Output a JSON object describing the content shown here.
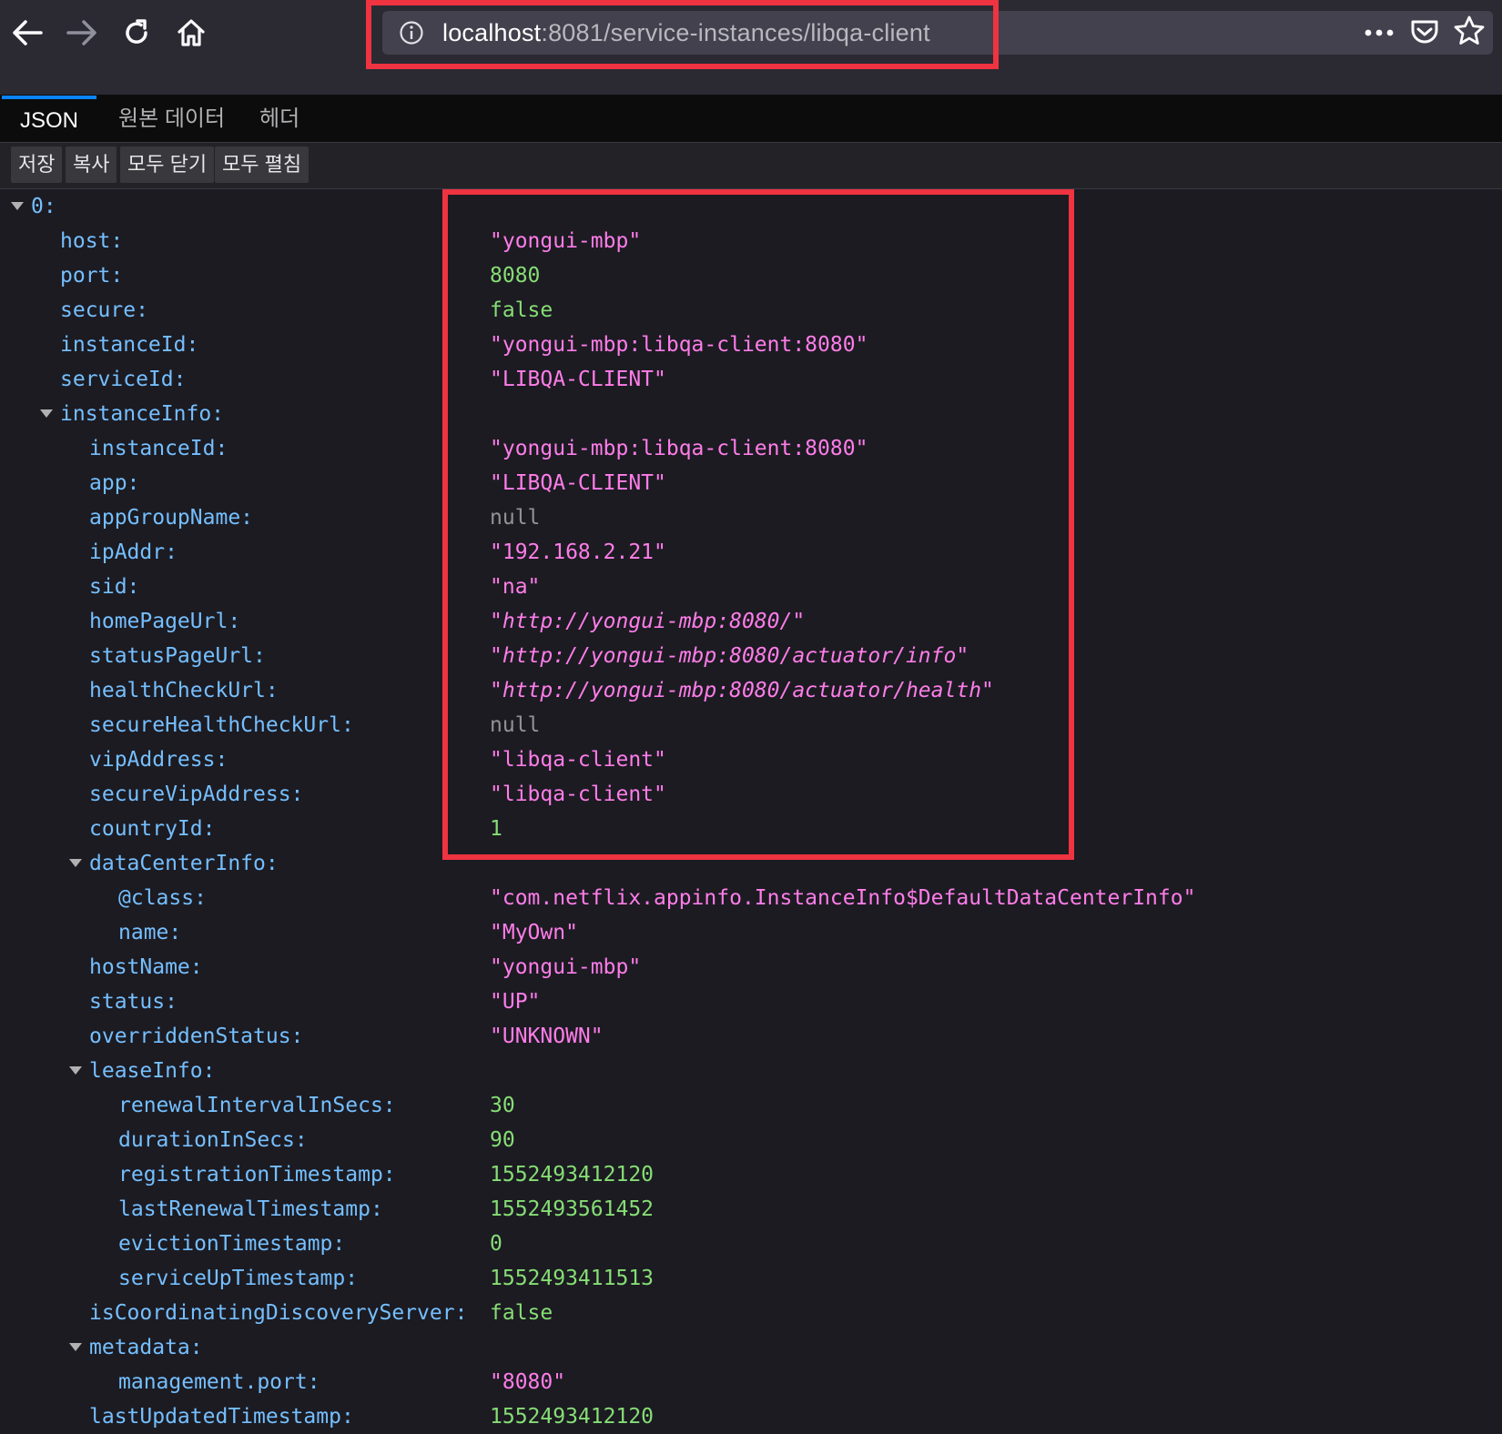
{
  "browser": {
    "url_host": "localhost",
    "url_path": ":8081/service-instances/libqa-client"
  },
  "tabs": [
    {
      "label": "JSON"
    },
    {
      "label": "원본 데이터"
    },
    {
      "label": "헤더"
    }
  ],
  "buttons": {
    "save": "저장",
    "copy": "복사",
    "collapse_all": "모두 닫기",
    "expand_all": "모두 펼침"
  },
  "tree": [
    {
      "key": "0:",
      "value": "",
      "type": "obj"
    },
    {
      "key": "host:",
      "value": "\"yongui-mbp\"",
      "type": "str"
    },
    {
      "key": "port:",
      "value": "8080",
      "type": "num"
    },
    {
      "key": "secure:",
      "value": "false",
      "type": "bool"
    },
    {
      "key": "instanceId:",
      "value": "\"yongui-mbp:libqa-client:8080\"",
      "type": "str"
    },
    {
      "key": "serviceId:",
      "value": "\"LIBQA-CLIENT\"",
      "type": "str"
    },
    {
      "key": "instanceInfo:",
      "value": "",
      "type": "obj"
    },
    {
      "key": "instanceId:",
      "value": "\"yongui-mbp:libqa-client:8080\"",
      "type": "str"
    },
    {
      "key": "app:",
      "value": "\"LIBQA-CLIENT\"",
      "type": "str"
    },
    {
      "key": "appGroupName:",
      "value": "null",
      "type": "nul"
    },
    {
      "key": "ipAddr:",
      "value": "\"192.168.2.21\"",
      "type": "str"
    },
    {
      "key": "sid:",
      "value": "\"na\"",
      "type": "str"
    },
    {
      "key": "homePageUrl:",
      "value": "\"http://yongui-mbp:8080/\"",
      "type": "url"
    },
    {
      "key": "statusPageUrl:",
      "value": "\"http://yongui-mbp:8080/actuator/info\"",
      "type": "url"
    },
    {
      "key": "healthCheckUrl:",
      "value": "\"http://yongui-mbp:8080/actuator/health\"",
      "type": "url"
    },
    {
      "key": "secureHealthCheckUrl:",
      "value": "null",
      "type": "nul"
    },
    {
      "key": "vipAddress:",
      "value": "\"libqa-client\"",
      "type": "str"
    },
    {
      "key": "secureVipAddress:",
      "value": "\"libqa-client\"",
      "type": "str"
    },
    {
      "key": "countryId:",
      "value": "1",
      "type": "num"
    },
    {
      "key": "dataCenterInfo:",
      "value": "",
      "type": "obj"
    },
    {
      "key": "@class:",
      "value": "\"com.netflix.appinfo.InstanceInfo$DefaultDataCenterInfo\"",
      "type": "str"
    },
    {
      "key": "name:",
      "value": "\"MyOwn\"",
      "type": "str"
    },
    {
      "key": "hostName:",
      "value": "\"yongui-mbp\"",
      "type": "str"
    },
    {
      "key": "status:",
      "value": "\"UP\"",
      "type": "str"
    },
    {
      "key": "overriddenStatus:",
      "value": "\"UNKNOWN\"",
      "type": "str"
    },
    {
      "key": "leaseInfo:",
      "value": "",
      "type": "obj"
    },
    {
      "key": "renewalIntervalInSecs:",
      "value": "30",
      "type": "num"
    },
    {
      "key": "durationInSecs:",
      "value": "90",
      "type": "num"
    },
    {
      "key": "registrationTimestamp:",
      "value": "1552493412120",
      "type": "num"
    },
    {
      "key": "lastRenewalTimestamp:",
      "value": "1552493561452",
      "type": "num"
    },
    {
      "key": "evictionTimestamp:",
      "value": "0",
      "type": "num"
    },
    {
      "key": "serviceUpTimestamp:",
      "value": "1552493411513",
      "type": "num"
    },
    {
      "key": "isCoordinatingDiscoveryServer:",
      "value": "false",
      "type": "bool"
    },
    {
      "key": "metadata:",
      "value": "",
      "type": "obj"
    },
    {
      "key": "management.port:",
      "value": "\"8080\"",
      "type": "str"
    },
    {
      "key": "lastUpdatedTimestamp:",
      "value": "1552493412120",
      "type": "num"
    }
  ]
}
